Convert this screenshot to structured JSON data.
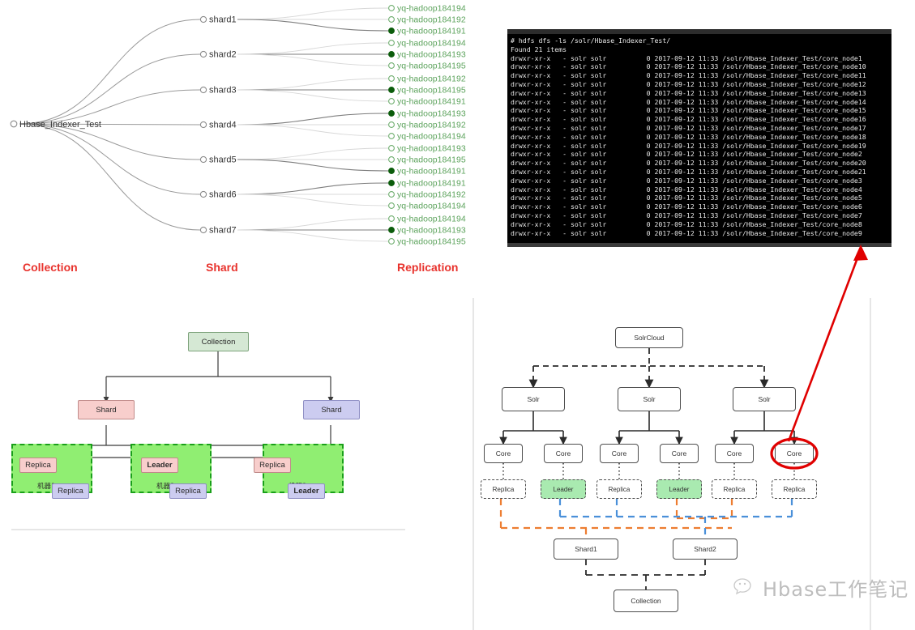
{
  "tree": {
    "root": "Hbase_Indexer_Test",
    "tiers": {
      "collection": "Collection",
      "shard": "Shard",
      "replication": "Replication"
    },
    "shards": [
      {
        "name": "shard1",
        "replicas": [
          {
            "host": "yq-hadoop184194",
            "leader": false
          },
          {
            "host": "yq-hadoop184192",
            "leader": false
          },
          {
            "host": "yq-hadoop184191",
            "leader": true
          }
        ]
      },
      {
        "name": "shard2",
        "replicas": [
          {
            "host": "yq-hadoop184194",
            "leader": false
          },
          {
            "host": "yq-hadoop184193",
            "leader": true
          },
          {
            "host": "yq-hadoop184195",
            "leader": false
          }
        ]
      },
      {
        "name": "shard3",
        "replicas": [
          {
            "host": "yq-hadoop184192",
            "leader": false
          },
          {
            "host": "yq-hadoop184195",
            "leader": true
          },
          {
            "host": "yq-hadoop184191",
            "leader": false
          }
        ]
      },
      {
        "name": "shard4",
        "replicas": [
          {
            "host": "yq-hadoop184193",
            "leader": true
          },
          {
            "host": "yq-hadoop184192",
            "leader": false
          },
          {
            "host": "yq-hadoop184194",
            "leader": false
          }
        ]
      },
      {
        "name": "shard5",
        "replicas": [
          {
            "host": "yq-hadoop184193",
            "leader": false
          },
          {
            "host": "yq-hadoop184195",
            "leader": false
          },
          {
            "host": "yq-hadoop184191",
            "leader": true
          }
        ]
      },
      {
        "name": "shard6",
        "replicas": [
          {
            "host": "yq-hadoop184191",
            "leader": true
          },
          {
            "host": "yq-hadoop184192",
            "leader": false
          },
          {
            "host": "yq-hadoop184194",
            "leader": false
          }
        ]
      },
      {
        "name": "shard7",
        "replicas": [
          {
            "host": "yq-hadoop184194",
            "leader": false
          },
          {
            "host": "yq-hadoop184193",
            "leader": true
          },
          {
            "host": "yq-hadoop184195",
            "leader": false
          }
        ]
      }
    ]
  },
  "terminal": {
    "command": "# hdfs dfs -ls /solr/Hbase_Indexer_Test/",
    "found": "Found 21 items",
    "lines": [
      "drwxr-xr-x   - solr solr          0 2017-09-12 11:33 /solr/Hbase_Indexer_Test/core_node1",
      "drwxr-xr-x   - solr solr          0 2017-09-12 11:33 /solr/Hbase_Indexer_Test/core_node10",
      "drwxr-xr-x   - solr solr          0 2017-09-12 11:33 /solr/Hbase_Indexer_Test/core_node11",
      "drwxr-xr-x   - solr solr          0 2017-09-12 11:33 /solr/Hbase_Indexer_Test/core_node12",
      "drwxr-xr-x   - solr solr          0 2017-09-12 11:33 /solr/Hbase_Indexer_Test/core_node13",
      "drwxr-xr-x   - solr solr          0 2017-09-12 11:33 /solr/Hbase_Indexer_Test/core_node14",
      "drwxr-xr-x   - solr solr          0 2017-09-12 11:33 /solr/Hbase_Indexer_Test/core_node15",
      "drwxr-xr-x   - solr solr          0 2017-09-12 11:33 /solr/Hbase_Indexer_Test/core_node16",
      "drwxr-xr-x   - solr solr          0 2017-09-12 11:33 /solr/Hbase_Indexer_Test/core_node17",
      "drwxr-xr-x   - solr solr          0 2017-09-12 11:33 /solr/Hbase_Indexer_Test/core_node18",
      "drwxr-xr-x   - solr solr          0 2017-09-12 11:33 /solr/Hbase_Indexer_Test/core_node19",
      "drwxr-xr-x   - solr solr          0 2017-09-12 11:33 /solr/Hbase_Indexer_Test/core_node2",
      "drwxr-xr-x   - solr solr          0 2017-09-12 11:33 /solr/Hbase_Indexer_Test/core_node20",
      "drwxr-xr-x   - solr solr          0 2017-09-12 11:33 /solr/Hbase_Indexer_Test/core_node21",
      "drwxr-xr-x   - solr solr          0 2017-09-12 11:33 /solr/Hbase_Indexer_Test/core_node3",
      "drwxr-xr-x   - solr solr          0 2017-09-12 11:33 /solr/Hbase_Indexer_Test/core_node4",
      "drwxr-xr-x   - solr solr          0 2017-09-12 11:33 /solr/Hbase_Indexer_Test/core_node5",
      "drwxr-xr-x   - solr solr          0 2017-09-12 11:33 /solr/Hbase_Indexer_Test/core_node6",
      "drwxr-xr-x   - solr solr          0 2017-09-12 11:33 /solr/Hbase_Indexer_Test/core_node7",
      "drwxr-xr-x   - solr solr          0 2017-09-12 11:33 /solr/Hbase_Indexer_Test/core_node8",
      "drwxr-xr-x   - solr solr          0 2017-09-12 11:33 /solr/Hbase_Indexer_Test/core_node9"
    ]
  },
  "replica_diagram": {
    "collection": "Collection",
    "shard_left": "Shard",
    "shard_right": "Shard",
    "nodes": [
      {
        "label": "Replica",
        "style": "pink",
        "bold": false
      },
      {
        "label": "Replica",
        "style": "purple",
        "bold": false
      },
      {
        "label": "Leader",
        "style": "pink",
        "bold": true
      },
      {
        "label": "Replica",
        "style": "purple",
        "bold": false
      },
      {
        "label": "Replica",
        "style": "pink",
        "bold": false
      },
      {
        "label": "Leader",
        "style": "purple",
        "bold": true
      }
    ],
    "machines": [
      "机器1",
      "机器2",
      "机器3"
    ]
  },
  "solrcloud_diagram": {
    "root": "SolrCloud",
    "solr": [
      "Solr",
      "Solr",
      "Solr"
    ],
    "cores": [
      "Core",
      "Core",
      "Core",
      "Core",
      "Core",
      "Core"
    ],
    "replicas": [
      {
        "label": "Replica",
        "leader": false,
        "shard": "Shard1"
      },
      {
        "label": "Leader",
        "leader": true,
        "shard": "Shard2"
      },
      {
        "label": "Replica",
        "leader": false,
        "shard": "Shard2"
      },
      {
        "label": "Leader",
        "leader": true,
        "shard": "Shard1"
      },
      {
        "label": "Replica",
        "leader": false,
        "shard": "Shard1"
      },
      {
        "label": "Replica",
        "leader": false,
        "shard": "Shard2"
      }
    ],
    "shards": [
      "Shard1",
      "Shard2"
    ],
    "collection": "Collection",
    "highlighted_core_index": 5
  },
  "watermark": {
    "text": "Hbase工作笔记"
  },
  "colors": {
    "tier_title": "#e8322c",
    "replica_text": "#5ca35c",
    "arrow": "#e00000",
    "green_box": "#d5e8d4",
    "pink_box": "#f8cecc",
    "purple_box": "#ccccf0",
    "machine_zone": "#90ee72",
    "machine_border": "#1aa01a",
    "shard1_link": "#ed7d31",
    "shard2_link": "#4a90d9",
    "terminal_bg": "#000000"
  }
}
